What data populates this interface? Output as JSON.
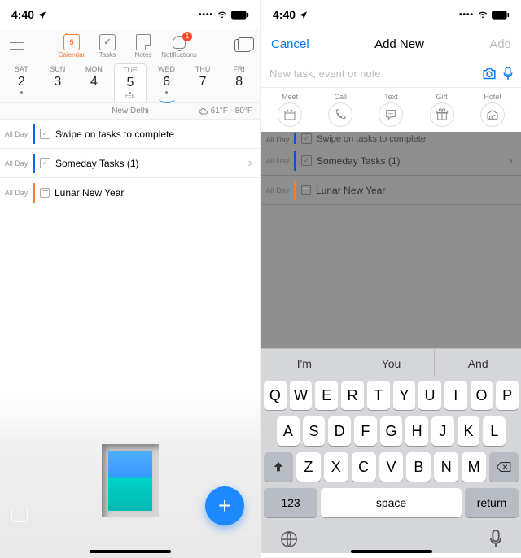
{
  "status": {
    "time": "4:40",
    "signal": "••••",
    "wifi": true,
    "battery": true
  },
  "toolbar": {
    "tabs": [
      {
        "label": "Calendar",
        "icon": "calendar",
        "active": true,
        "day": "5"
      },
      {
        "label": "Tasks",
        "icon": "check"
      },
      {
        "label": "Notes",
        "icon": "note"
      },
      {
        "label": "Notifications",
        "icon": "bell",
        "badge": "1"
      }
    ]
  },
  "week": [
    {
      "dow": "SAT",
      "num": "2",
      "dot": true
    },
    {
      "dow": "SUN",
      "num": "3"
    },
    {
      "dow": "MON",
      "num": "4"
    },
    {
      "dow": "TUE",
      "num": "5",
      "dot": true,
      "today": true,
      "feb": "FEB"
    },
    {
      "dow": "WED",
      "num": "6",
      "dot": true,
      "selected": true
    },
    {
      "dow": "THU",
      "num": "7"
    },
    {
      "dow": "FRI",
      "num": "8"
    }
  ],
  "location": {
    "city": "New Delhi",
    "weather": "61°F - 80°F"
  },
  "tasks": [
    {
      "allday": "All Day",
      "bar": "blue",
      "type": "check",
      "text": "Swipe on tasks to complete"
    },
    {
      "allday": "All Day",
      "bar": "blue",
      "type": "check",
      "text": "Someday Tasks (1)",
      "chev": true
    },
    {
      "allday": "All Day",
      "bar": "orange",
      "type": "cal",
      "text": "Lunar New Year"
    }
  ],
  "screen2": {
    "cancel": "Cancel",
    "title": "Add New",
    "add": "Add",
    "placeholder": "New task, event or note",
    "quick": [
      {
        "label": "Meet",
        "icon": "⊞"
      },
      {
        "label": "Call",
        "icon": "✆"
      },
      {
        "label": "Text",
        "icon": "💬"
      },
      {
        "label": "Gift",
        "icon": "⎕"
      },
      {
        "label": "Hotel",
        "icon": "⌂"
      }
    ],
    "suggestions": [
      "I'm",
      "You",
      "And"
    ],
    "keyboard": {
      "row1": [
        "Q",
        "W",
        "E",
        "R",
        "T",
        "Y",
        "U",
        "I",
        "O",
        "P"
      ],
      "row2": [
        "A",
        "S",
        "D",
        "F",
        "G",
        "H",
        "J",
        "K",
        "L"
      ],
      "row3": [
        "Z",
        "X",
        "C",
        "V",
        "B",
        "N",
        "M"
      ],
      "num": "123",
      "space": "space",
      "return": "return"
    }
  }
}
